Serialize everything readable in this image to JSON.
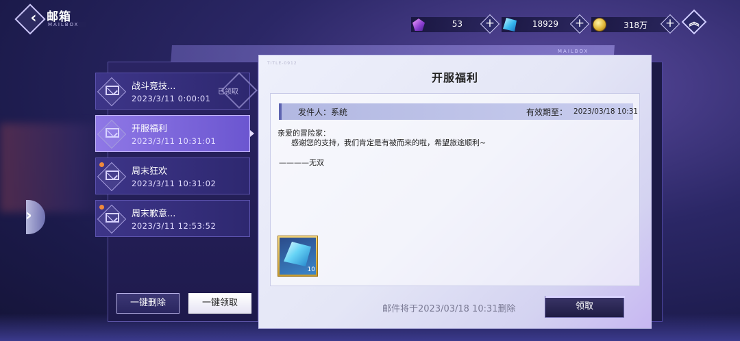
{
  "header": {
    "title": "邮箱",
    "subtitle": "MAILBOX"
  },
  "currencies": [
    {
      "icon": "purple-gem-icon",
      "value": "53"
    },
    {
      "icon": "blue-crystal-icon",
      "value": "18929"
    },
    {
      "icon": "gold-coin-icon",
      "value": "318万"
    }
  ],
  "plus_label": "+",
  "back_card_label": "MAILBOX",
  "mails": [
    {
      "title": "战斗竞技...",
      "date": "2023/3/11 0:00:01",
      "status": "已领取",
      "unread": false,
      "selected": false
    },
    {
      "title": "开服福利",
      "date": "2023/3/11 10:31:01",
      "status": "",
      "unread": false,
      "selected": true
    },
    {
      "title": "周末狂欢",
      "date": "2023/3/11 10:31:02",
      "status": "",
      "unread": true,
      "selected": false
    },
    {
      "title": "周末歉意...",
      "date": "2023/3/11 12:53:52",
      "status": "",
      "unread": true,
      "selected": false
    }
  ],
  "buttons": {
    "delete_all": "一键删除",
    "claim_all": "一键领取",
    "claim": "领取"
  },
  "detail": {
    "tag": "TITLE-0912",
    "title": "开服福利",
    "sender": "发件人：系统",
    "expiry_label": "有效期至：",
    "expiry_value": "2023/03/18 10:31",
    "greeting": "亲爱的冒险家：",
    "body": "感谢您的支持，我们肯定是有被而来的啦，希望旅途顺利~",
    "signature": "————无双",
    "reward": {
      "icon": "blue-crystal-icon",
      "qty": "10"
    },
    "expire_note": "邮件将于2023/03/18 10:31删除"
  },
  "colors": {
    "accent": "#7b63dc",
    "unread_dot": "#f08a3c",
    "reward_frame": "#e0b53f"
  }
}
